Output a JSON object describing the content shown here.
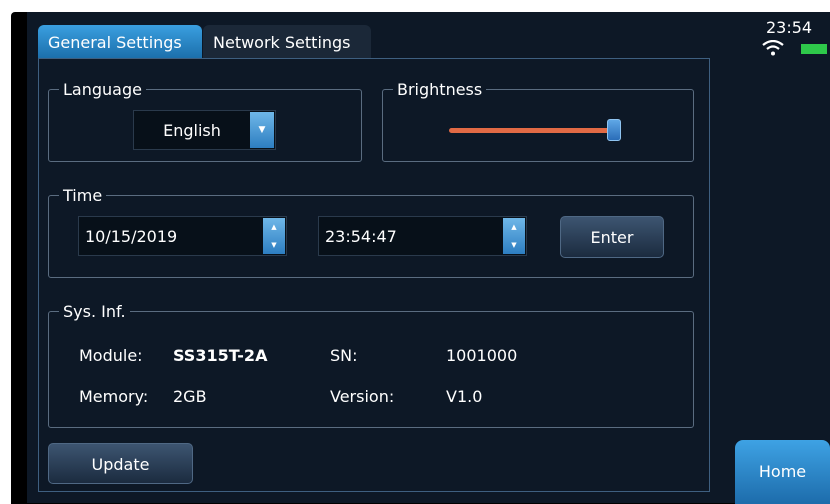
{
  "tabs": [
    {
      "label": "General Settings",
      "active": true
    },
    {
      "label": "Network Settings",
      "active": false
    }
  ],
  "language": {
    "legend": "Language",
    "selected": "English",
    "dropdown_icon": "small-down-arrow"
  },
  "brightness": {
    "legend": "Brightness",
    "level_fraction": 0.96
  },
  "time": {
    "legend": "Time",
    "date_value": "10/15/2019",
    "time_value": "23:54:47",
    "enter_label": "Enter",
    "spinner_icon": "up-down-arrows"
  },
  "sysinfo": {
    "legend": "Sys. Inf.",
    "module_label": "Module:",
    "module_value": "SS315T-2A",
    "sn_label": "SN:",
    "sn_value": "1001000",
    "memory_label": "Memory:",
    "memory_value": "2GB",
    "version_label": "Version:",
    "version_value": "V1.0"
  },
  "update_label": "Update",
  "status": {
    "clock": "23:54",
    "wifi_icon": "wifi-icon",
    "battery_icon": "battery-icon",
    "battery_color": "#2ec84a"
  },
  "home_label": "Home",
  "colors": {
    "accent": "#2a86cc",
    "slider": "#e16a45",
    "panel": "#0d1826"
  }
}
